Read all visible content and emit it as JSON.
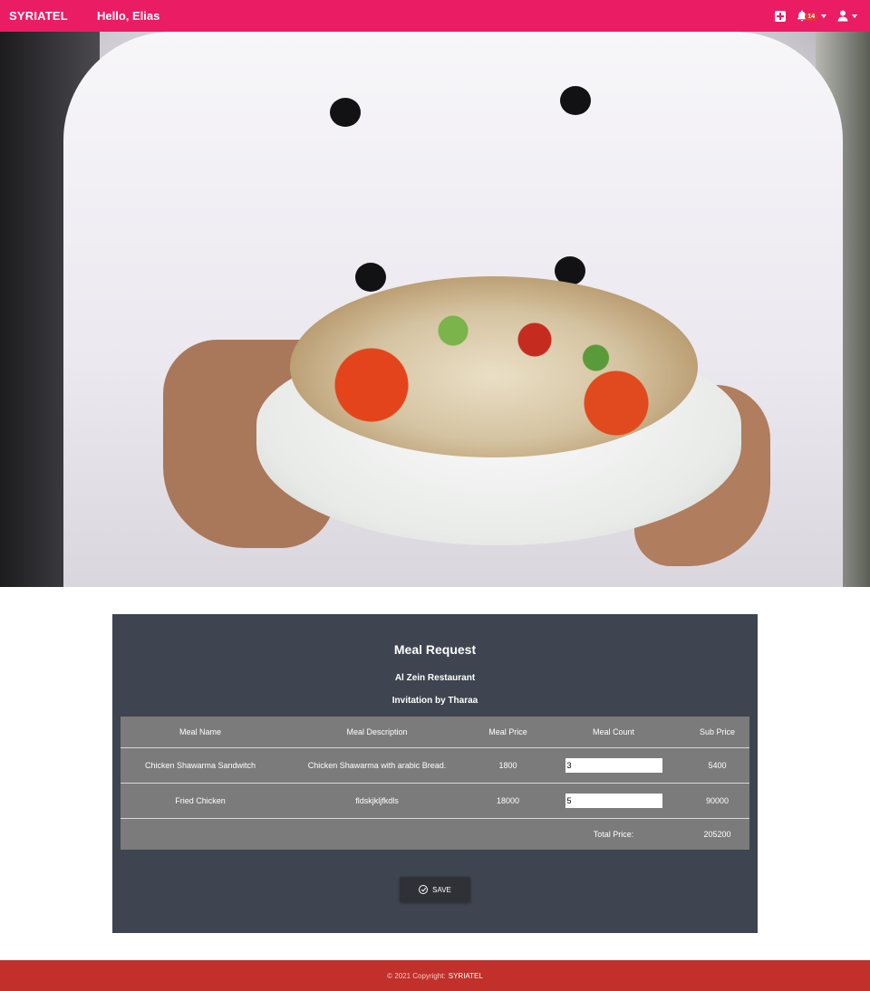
{
  "navbar": {
    "brand": "SYRIATEL",
    "greeting": "Hello, Elias",
    "notification_count": "14",
    "icons": [
      "plus-square-icon",
      "bell-icon",
      "user-icon"
    ],
    "color": "#ea1c64"
  },
  "meal_request": {
    "title": "Meal Request",
    "restaurant": "Al Zein Restaurant",
    "invitation": "Invitation by Tharaa",
    "columns": [
      "Meal Name",
      "Meal Description",
      "Meal Price",
      "Meal Count",
      "Sub Price"
    ],
    "rows": [
      {
        "name": "Chicken Shawarma Sandwitch",
        "description": "Chicken Shawarma with arabic Bread.",
        "price": "1800",
        "count": "3",
        "sub_price": "5400"
      },
      {
        "name": "Fried Chicken",
        "description": "fldskjkljfkdls",
        "price": "18000",
        "count": "5",
        "sub_price": "90000"
      }
    ],
    "total_label": "Total Price:",
    "total_value": "205200",
    "save_label": "SAVE"
  },
  "footer": {
    "copyright": "© 2021 Copyright:",
    "brand": "SYRIATEL",
    "color": "#c1302a"
  }
}
